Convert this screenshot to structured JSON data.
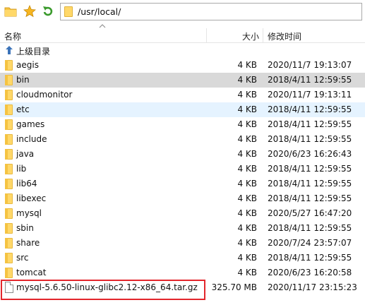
{
  "path": "/usr/local/",
  "headers": {
    "name": "名称",
    "size": "大小",
    "modified": "修改时间"
  },
  "parent": {
    "label": "上级目录"
  },
  "files": [
    {
      "name": "aegis",
      "size": "4 KB",
      "modified": "2020/11/7 19:13:07",
      "kind": "folder"
    },
    {
      "name": "bin",
      "size": "4 KB",
      "modified": "2018/4/11 12:59:55",
      "kind": "folder",
      "state": "selected"
    },
    {
      "name": "cloudmonitor",
      "size": "4 KB",
      "modified": "2020/11/7 19:13:11",
      "kind": "folder"
    },
    {
      "name": "etc",
      "size": "4 KB",
      "modified": "2018/4/11 12:59:55",
      "kind": "folder",
      "state": "hover"
    },
    {
      "name": "games",
      "size": "4 KB",
      "modified": "2018/4/11 12:59:55",
      "kind": "folder"
    },
    {
      "name": "include",
      "size": "4 KB",
      "modified": "2018/4/11 12:59:55",
      "kind": "folder"
    },
    {
      "name": "java",
      "size": "4 KB",
      "modified": "2020/6/23 16:26:43",
      "kind": "folder"
    },
    {
      "name": "lib",
      "size": "4 KB",
      "modified": "2018/4/11 12:59:55",
      "kind": "folder"
    },
    {
      "name": "lib64",
      "size": "4 KB",
      "modified": "2018/4/11 12:59:55",
      "kind": "folder"
    },
    {
      "name": "libexec",
      "size": "4 KB",
      "modified": "2018/4/11 12:59:55",
      "kind": "folder"
    },
    {
      "name": "mysql",
      "size": "4 KB",
      "modified": "2020/5/27 16:47:20",
      "kind": "folder"
    },
    {
      "name": "sbin",
      "size": "4 KB",
      "modified": "2018/4/11 12:59:55",
      "kind": "folder"
    },
    {
      "name": "share",
      "size": "4 KB",
      "modified": "2020/7/24 23:57:07",
      "kind": "folder"
    },
    {
      "name": "src",
      "size": "4 KB",
      "modified": "2018/4/11 12:59:55",
      "kind": "folder"
    },
    {
      "name": "tomcat",
      "size": "4 KB",
      "modified": "2020/6/23 16:20:58",
      "kind": "folder"
    },
    {
      "name": "mysql-5.6.50-linux-glibc2.12-x86_64.tar.gz",
      "size": "325.70 MB",
      "modified": "2020/11/17 23:15:23",
      "kind": "file"
    }
  ],
  "colors": {
    "selected": "#d9d9d9",
    "hover": "#e5f3ff",
    "highlight_box": "#e3262c",
    "folder": "#ffd869"
  },
  "icons": [
    "folder-icon",
    "star-icon",
    "refresh-icon",
    "up-arrow-icon",
    "file-icon"
  ]
}
